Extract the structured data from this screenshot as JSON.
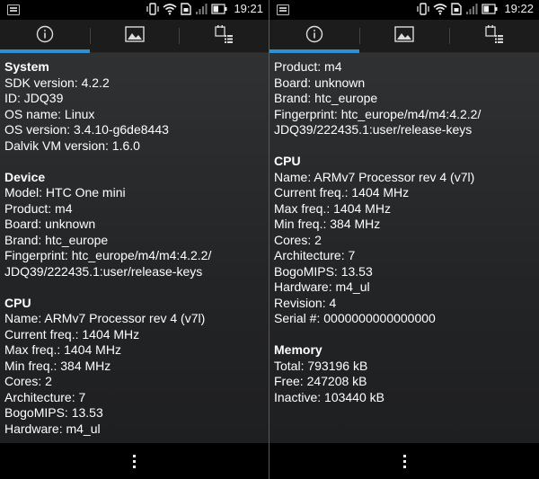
{
  "colors": {
    "accent": "#2f8fd2",
    "background": "#232426"
  },
  "left": {
    "status": {
      "time": "19:21"
    },
    "tabs": [
      {
        "icon": "info-icon",
        "active": true
      },
      {
        "icon": "image-icon",
        "active": false
      },
      {
        "icon": "tasks-icon",
        "active": false
      }
    ],
    "sections": [
      {
        "title": "System",
        "lines": [
          "SDK version: 4.2.2",
          "ID: JDQ39",
          "OS name: Linux",
          "OS version: 3.4.10-g6de8443",
          "Dalvik VM version: 1.6.0"
        ]
      },
      {
        "title": "Device",
        "lines": [
          "Model: HTC One mini",
          "Product: m4",
          "Board: unknown",
          "Brand: htc_europe",
          "Fingerprint: htc_europe/m4/m4:4.2.2/",
          "JDQ39/222435.1:user/release-keys"
        ]
      },
      {
        "title": "CPU",
        "lines": [
          "Name: ARMv7 Processor rev 4 (v7l)",
          "Current freq.: 1404 MHz",
          "Max freq.: 1404 MHz",
          "Min freq.: 384 MHz",
          "Cores: 2",
          "Architecture: 7",
          "BogoMIPS: 13.53",
          "Hardware: m4_ul"
        ]
      }
    ]
  },
  "right": {
    "status": {
      "time": "19:22"
    },
    "tabs": [
      {
        "icon": "info-icon",
        "active": true
      },
      {
        "icon": "image-icon",
        "active": false
      },
      {
        "icon": "tasks-icon",
        "active": false
      }
    ],
    "sections": [
      {
        "title": "",
        "lines": [
          "Product: m4",
          "Board: unknown",
          "Brand: htc_europe",
          "Fingerprint: htc_europe/m4/m4:4.2.2/",
          "JDQ39/222435.1:user/release-keys"
        ]
      },
      {
        "title": "CPU",
        "lines": [
          "Name: ARMv7 Processor rev 4 (v7l)",
          "Current freq.: 1404 MHz",
          "Max freq.: 1404 MHz",
          "Min freq.: 384 MHz",
          "Cores: 2",
          "Architecture: 7",
          "BogoMIPS: 13.53",
          "Hardware: m4_ul",
          "Revision: 4",
          "Serial #: 0000000000000000"
        ]
      },
      {
        "title": "Memory",
        "lines": [
          "Total: 793196 kB",
          "Free: 247208 kB",
          "Inactive: 103440 kB"
        ]
      }
    ]
  }
}
